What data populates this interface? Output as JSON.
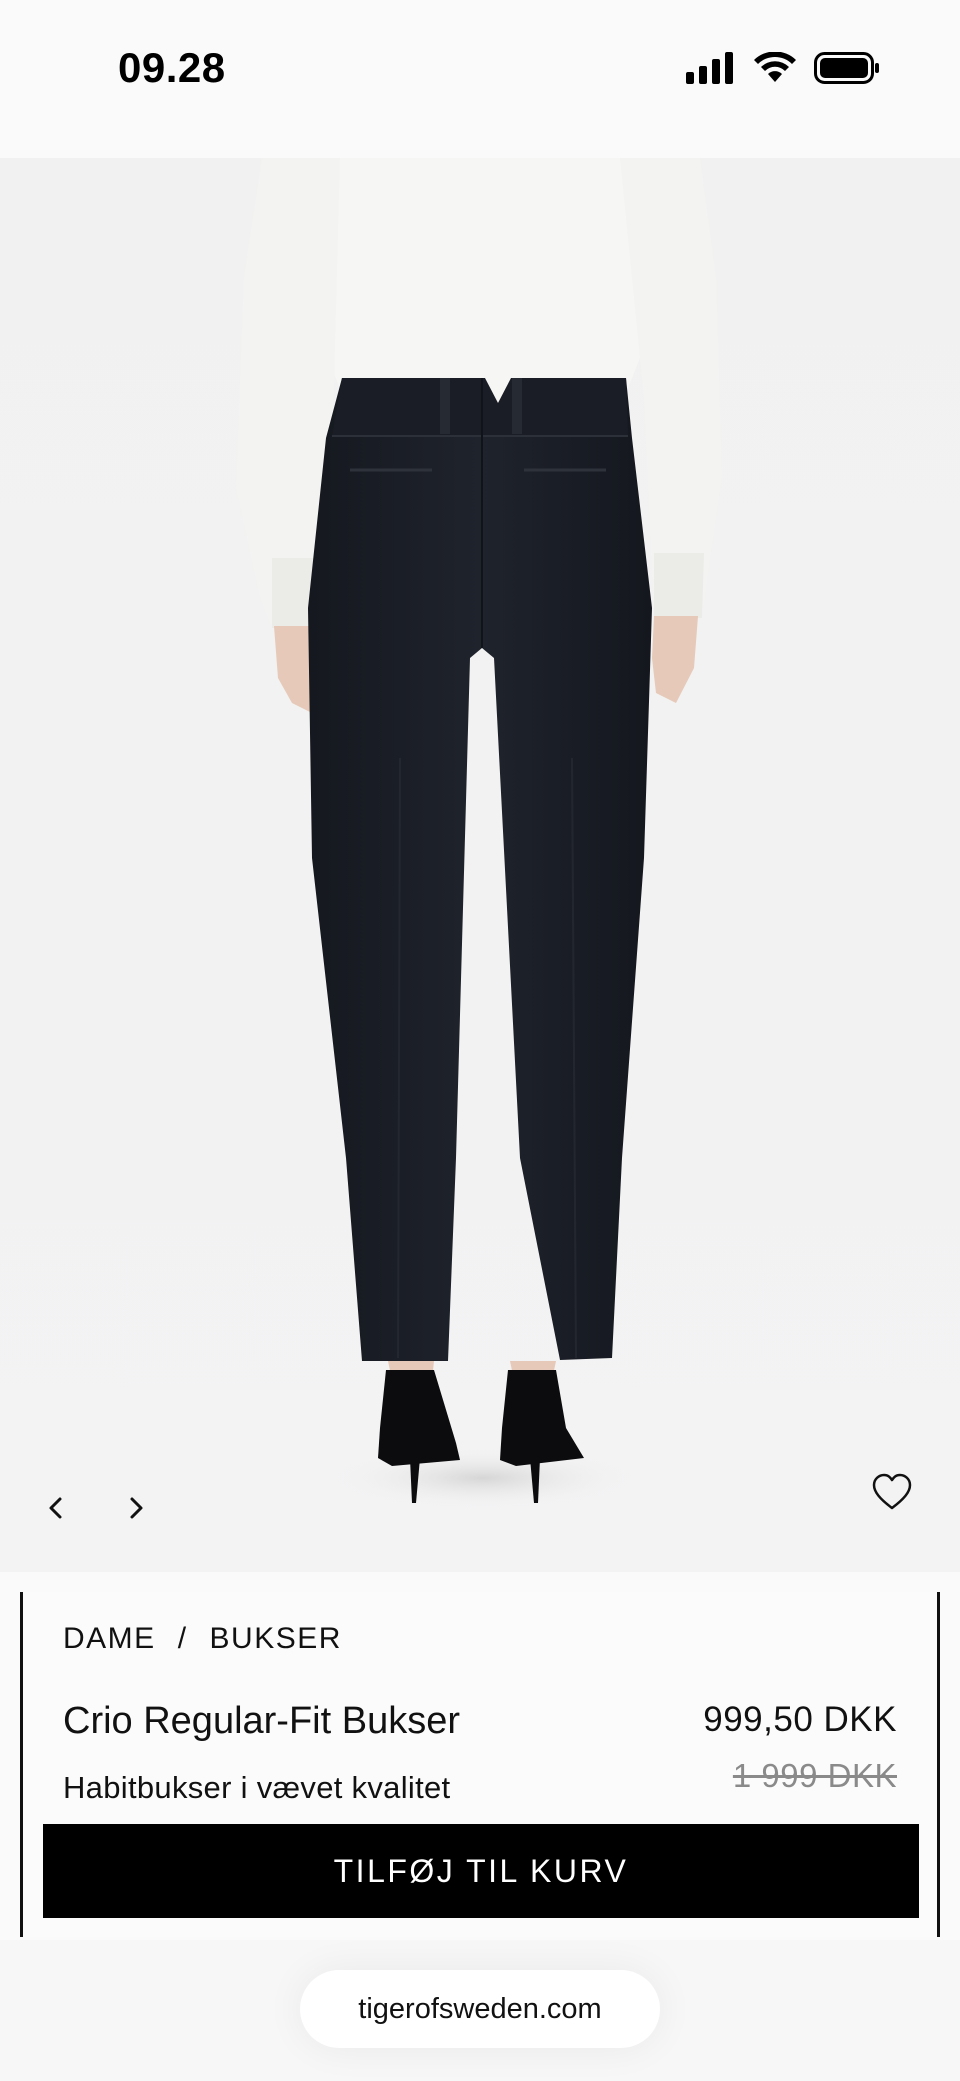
{
  "status_bar": {
    "time": "09.28",
    "icons": [
      "signal-icon",
      "wifi-icon",
      "battery-icon"
    ]
  },
  "gallery": {
    "prev_icon": "chevron-left-icon",
    "next_icon": "chevron-right-icon",
    "wishlist_icon": "heart-outline-icon"
  },
  "product": {
    "breadcrumb": [
      "DAME",
      "BUKSER"
    ],
    "breadcrumb_separator": "/",
    "title": "Crio Regular-Fit Bukser",
    "subtitle": "Habitbukser i vævet kvalitet",
    "price_current": "999,50 DKK",
    "price_original": "1 999 DKK",
    "add_to_cart_label": "TILFØJ TIL KURV"
  },
  "browser": {
    "url": "tigerofsweden.com"
  },
  "colors": {
    "background": "#fafafa",
    "button": "#000000",
    "button_text": "#ffffff",
    "price_old": "#8a8a8a",
    "trousers": "#1b1e26",
    "shirt": "#f6f6f4"
  }
}
